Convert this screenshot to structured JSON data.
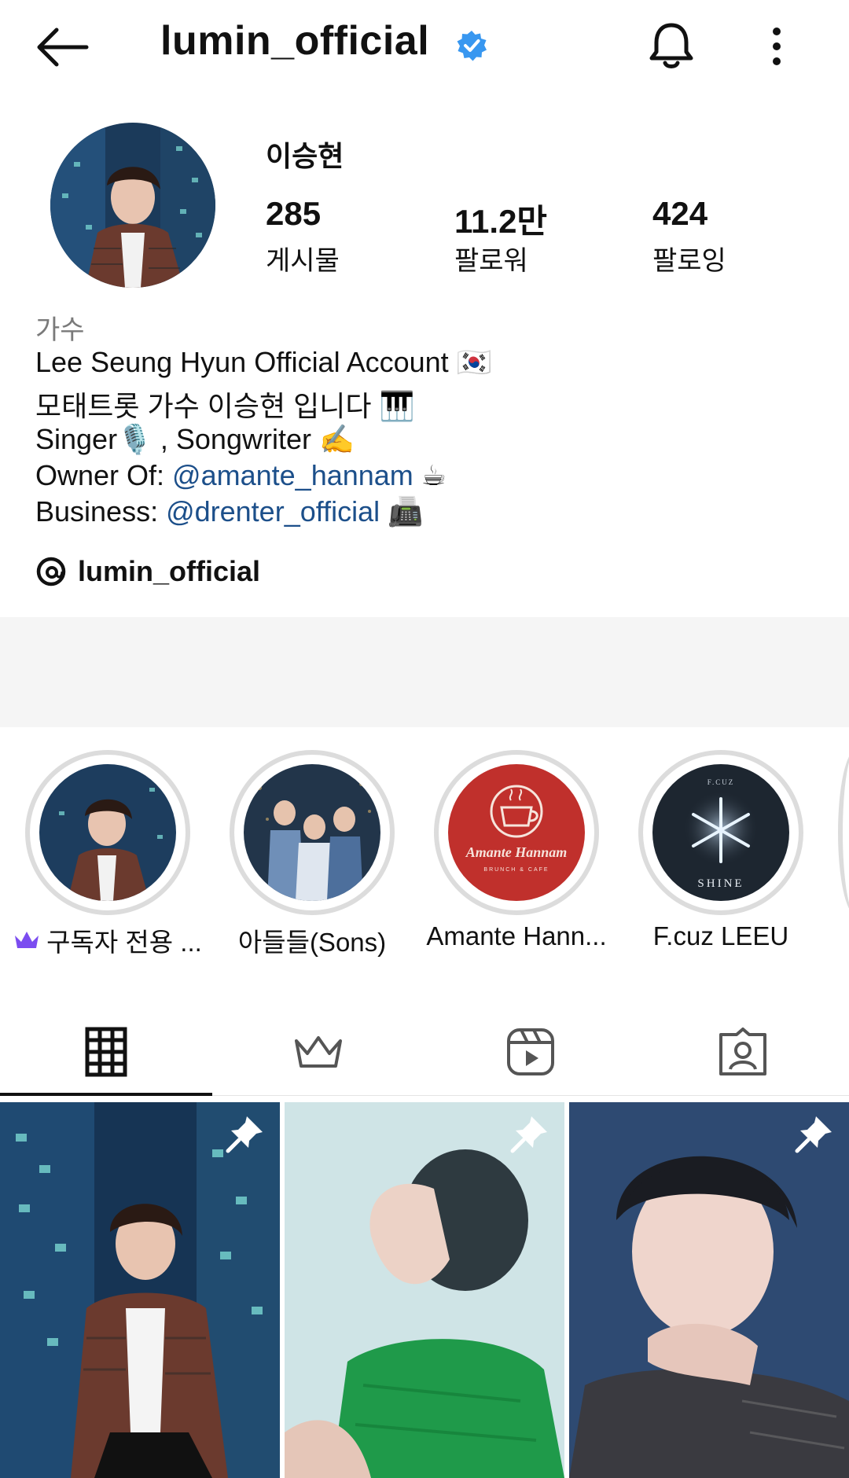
{
  "header": {
    "username": "lumin_official"
  },
  "profile": {
    "display_name": "이승현",
    "stats": [
      {
        "value": "285",
        "label": "게시물"
      },
      {
        "value": "11.2만",
        "label": "팔로워"
      },
      {
        "value": "424",
        "label": "팔로잉"
      }
    ],
    "category": "가수",
    "bio": {
      "line1": "Lee Seung Hyun Official Account 🇰🇷",
      "line2": "모태트롯 가수 이승현 입니다 🎹",
      "line3": "Singer🎙️ , Songwriter ✍️",
      "line4_prefix": "Owner Of: ",
      "line4_mention": "@amante_hannam",
      "line4_suffix": " ☕",
      "line5_prefix": "Business: ",
      "line5_mention": "@drenter_official",
      "line5_suffix": " 📠"
    },
    "threads_handle": "lumin_official"
  },
  "highlights": [
    {
      "label": "구독자 전용 ..."
    },
    {
      "label": "아들들(Sons)"
    },
    {
      "label": "Amante Hann..."
    },
    {
      "label": "F.cuz LEEU"
    }
  ],
  "highlight_art": {
    "amante_title": "Amante Hannam",
    "amante_sub": "BRUNCH & CAFE",
    "fcuz_top": "F.CUZ",
    "fcuz_bottom": "SHINE"
  },
  "tabs": [
    "grid-tab",
    "subscriber-tab",
    "reels-tab",
    "tagged-tab"
  ],
  "colors": {
    "verified": "#3897f0",
    "mention": "#1c4f8a",
    "crown": "#7b4cf0"
  }
}
